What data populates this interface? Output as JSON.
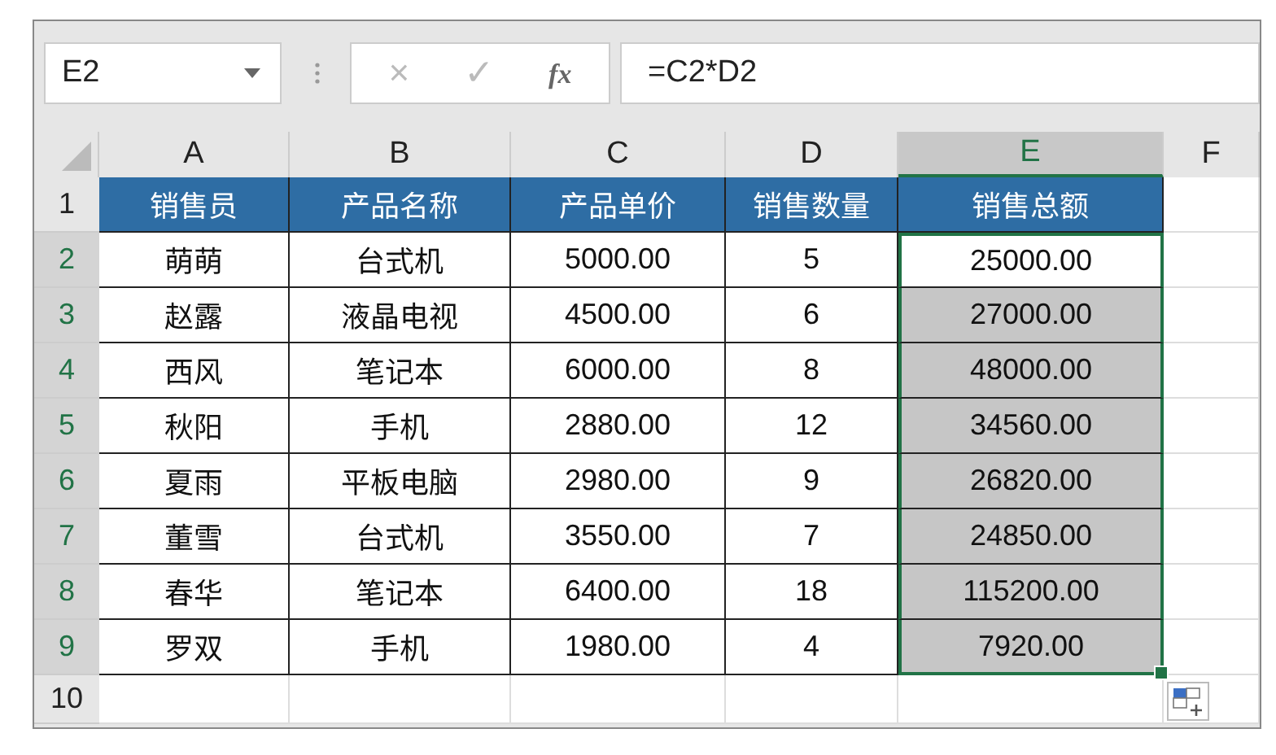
{
  "name_box": "E2",
  "formula": "=C2*D2",
  "formula_icons": {
    "cancel": "×",
    "enter": "✓",
    "function": "fx"
  },
  "columns": [
    {
      "label": "A",
      "selected": false
    },
    {
      "label": "B",
      "selected": false
    },
    {
      "label": "C",
      "selected": false
    },
    {
      "label": "D",
      "selected": false
    },
    {
      "label": "E",
      "selected": true
    },
    {
      "label": "F",
      "selected": false
    }
  ],
  "header_row": {
    "number": "1",
    "selected": false,
    "cells": [
      "销售员",
      "产品名称",
      "产品单价",
      "销售数量",
      "销售总额"
    ]
  },
  "rows": [
    {
      "number": "2",
      "selected": true,
      "active": true,
      "cells": [
        "萌萌",
        "台式机",
        "5000.00",
        "5",
        "25000.00"
      ]
    },
    {
      "number": "3",
      "selected": true,
      "active": false,
      "cells": [
        "赵露",
        "液晶电视",
        "4500.00",
        "6",
        "27000.00"
      ]
    },
    {
      "number": "4",
      "selected": true,
      "active": false,
      "cells": [
        "西风",
        "笔记本",
        "6000.00",
        "8",
        "48000.00"
      ]
    },
    {
      "number": "5",
      "selected": true,
      "active": false,
      "cells": [
        "秋阳",
        "手机",
        "2880.00",
        "12",
        "34560.00"
      ]
    },
    {
      "number": "6",
      "selected": true,
      "active": false,
      "cells": [
        "夏雨",
        "平板电脑",
        "2980.00",
        "9",
        "26820.00"
      ]
    },
    {
      "number": "7",
      "selected": true,
      "active": false,
      "cells": [
        "董雪",
        "台式机",
        "3550.00",
        "7",
        "24850.00"
      ]
    },
    {
      "number": "8",
      "selected": true,
      "active": false,
      "cells": [
        "春华",
        "笔记本",
        "6400.00",
        "18",
        "115200.00"
      ]
    },
    {
      "number": "9",
      "selected": true,
      "active": false,
      "cells": [
        "罗双",
        "手机",
        "1980.00",
        "4",
        "7920.00"
      ]
    }
  ],
  "empty_row": {
    "number": "10",
    "selected": false
  }
}
